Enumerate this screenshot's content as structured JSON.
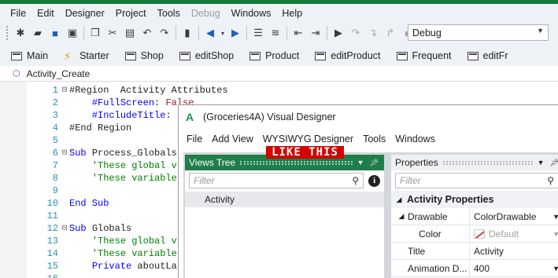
{
  "menu": [
    "File",
    "Edit",
    "Designer",
    "Project",
    "Tools",
    "Debug",
    "Windows",
    "Help"
  ],
  "menu_disabled": [
    "Debug"
  ],
  "config_combo": {
    "value": "Debug"
  },
  "module_tabs": [
    "Main",
    "Starter",
    "Shop",
    "editShop",
    "Product",
    "editProduct",
    "Frequent",
    "editFr"
  ],
  "doc_tab": {
    "label": "Activity_Create"
  },
  "code_lines": [
    {
      "n": "1",
      "fold": "⊟",
      "parts": [
        [
          "pl",
          "#Region  Activity Attributes"
        ]
      ]
    },
    {
      "n": "2",
      "fold": "",
      "parts": [
        [
          "pl",
          "    "
        ],
        [
          "kw",
          "#FullScreen"
        ],
        [
          "pl",
          ": "
        ],
        [
          "str",
          "False"
        ]
      ]
    },
    {
      "n": "3",
      "fold": "",
      "parts": [
        [
          "pl",
          "    "
        ],
        [
          "kw",
          "#IncludeTitle"
        ],
        [
          "pl",
          ": "
        ]
      ]
    },
    {
      "n": "4",
      "fold": "",
      "parts": [
        [
          "pl",
          "#End Region"
        ]
      ]
    },
    {
      "n": "5",
      "fold": "",
      "parts": []
    },
    {
      "n": "6",
      "fold": "⊟",
      "parts": [
        [
          "kw",
          "Sub "
        ],
        [
          "pl",
          "Process_Globals"
        ]
      ]
    },
    {
      "n": "7",
      "fold": "",
      "parts": [
        [
          "pl",
          "    "
        ],
        [
          "cm",
          "'These global v"
        ]
      ]
    },
    {
      "n": "8",
      "fold": "",
      "parts": [
        [
          "pl",
          "    "
        ],
        [
          "cm",
          "'These variable"
        ]
      ]
    },
    {
      "n": "9",
      "fold": "",
      "parts": []
    },
    {
      "n": "10",
      "fold": "",
      "parts": [
        [
          "kw",
          "End Sub"
        ]
      ]
    },
    {
      "n": "11",
      "fold": "",
      "parts": []
    },
    {
      "n": "12",
      "fold": "⊟",
      "parts": [
        [
          "kw",
          "Sub "
        ],
        [
          "pl",
          "Globals"
        ]
      ]
    },
    {
      "n": "13",
      "fold": "",
      "parts": [
        [
          "pl",
          "    "
        ],
        [
          "cm",
          "'These global v"
        ]
      ]
    },
    {
      "n": "14",
      "fold": "",
      "parts": [
        [
          "pl",
          "    "
        ],
        [
          "cm",
          "'These variable"
        ]
      ]
    },
    {
      "n": "15",
      "fold": "",
      "parts": [
        [
          "pl",
          "    "
        ],
        [
          "kw",
          "Private "
        ],
        [
          "pl",
          "aboutLa"
        ]
      ]
    },
    {
      "n": "16",
      "fold": "",
      "parts": []
    }
  ],
  "designer": {
    "title": "(Groceries4A) Visual Designer",
    "menu": [
      "File",
      "Add View",
      "WYSIWYG Designer",
      "Tools",
      "Windows"
    ],
    "views_tree": {
      "header": "Views Tree",
      "filter_placeholder": "Filter",
      "items": [
        "Activity"
      ]
    },
    "properties": {
      "header": "Properties",
      "filter_placeholder": "Filter",
      "section": "Activity Properties",
      "rows": [
        {
          "key": "Drawable",
          "value": "ColorDrawable",
          "expander": true,
          "dropdown": true,
          "muted": false,
          "swatch": false
        },
        {
          "key": "Color",
          "value": "Default",
          "expander": false,
          "dropdown": true,
          "muted": true,
          "swatch": true,
          "indent": true
        },
        {
          "key": "Title",
          "value": "Activity",
          "expander": false,
          "dropdown": false,
          "muted": false,
          "swatch": false
        },
        {
          "key": "Animation D...",
          "value": "400",
          "expander": false,
          "dropdown": true,
          "muted": false,
          "swatch": false
        }
      ]
    }
  },
  "stamp": {
    "text": "LIKE THIS"
  },
  "colors": {
    "accent_green": "#1e7f4a",
    "keyword": "#0000ff",
    "comment": "#008000",
    "string": "#a31515",
    "stamp_red": "#d40000"
  }
}
